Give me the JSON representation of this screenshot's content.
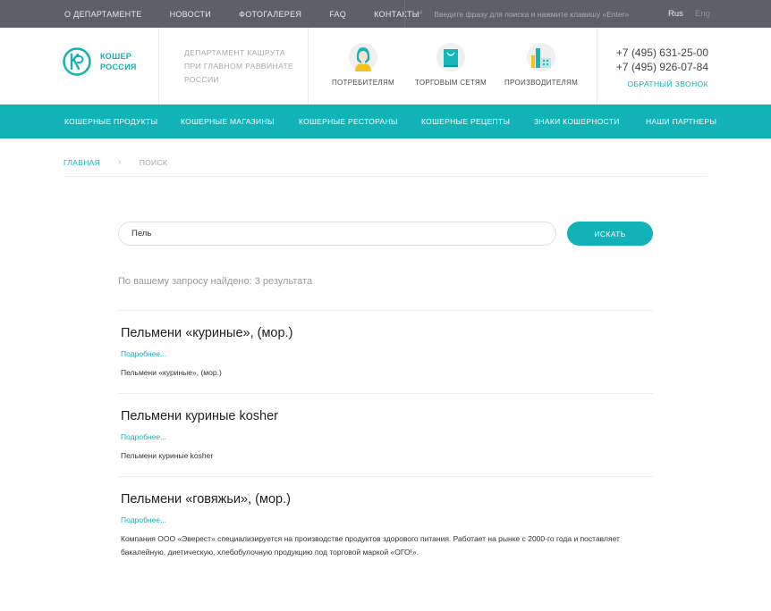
{
  "topbar": {
    "nav": [
      "О ДЕПАРТАМЕНТЕ",
      "НОВОСТИ",
      "ФОТОГАЛЕРЕЯ",
      "FAQ",
      "КОНТАКТЫ"
    ],
    "search_placeholder": "Введите фразу для поиска и нажмите клавишу «Enter»",
    "lang_ru": "Rus",
    "lang_en": "Eng"
  },
  "header": {
    "logo_line1": "КОШЕР",
    "logo_line2": "РОССИЯ",
    "dept_line1": "ДЕПАРТАМЕНТ КАШРУТА",
    "dept_line2": "ПРИ ГЛАВНОМ РАВВИНАТЕ",
    "dept_line3": "РОССИИ",
    "categories": [
      {
        "label": "ПОТРЕБИТЕЛЯМ",
        "icon": "consumer-icon"
      },
      {
        "label": "ТОРГОВЫМ СЕТЯМ",
        "icon": "shopping-bag-icon"
      },
      {
        "label": "ПРОИЗВОДИТЕЛЯМ",
        "icon": "factory-icon"
      }
    ],
    "phone1": "+7 (495) 631-25-00",
    "phone2": "+7 (495) 926-07-84",
    "callback": "ОБРАТНЫЙ ЗВОНОК"
  },
  "mainnav": [
    "КОШЕРНЫЕ ПРОДУКТЫ",
    "КОШЕРНЫЕ МАГАЗИНЫ",
    "КОШЕРНЫЕ РЕСТОРАНЫ",
    "КОШЕРНЫЕ РЕЦЕПТЫ",
    "ЗНАКИ КОШЕРНОСТИ",
    "НАШИ ПАРТНЕРЫ"
  ],
  "breadcrumb": {
    "home": "ГЛАВНАЯ",
    "separator": "›",
    "current": "ПОИСК"
  },
  "search": {
    "value": "Пель",
    "button": "ИСКАТЬ",
    "summary": "По вашему запросу найдено: 3 результата"
  },
  "results": [
    {
      "title": "Пельмени «куриные», (мор.)",
      "more": "Подробнее...",
      "text": "Пельмени «куриные», (мор.)"
    },
    {
      "title": "Пельмени куриные kosher",
      "more": "Подробнее...",
      "text": "Пельмени куриные kosher"
    },
    {
      "title": "Пельмени «говяжьи», (мор.)",
      "more": "Подробнее...",
      "text": "Компания ООО «Эверест» специализируется на производстве продуктов здорового питания. Работает на рынке с 2000-го года и поставляет бакалейную, диетическую, хлебобулочную продукцию под торговой маркой «ОГО!»."
    }
  ],
  "colors": {
    "brand": "#12b3b6",
    "topbar": "#5d6166"
  }
}
